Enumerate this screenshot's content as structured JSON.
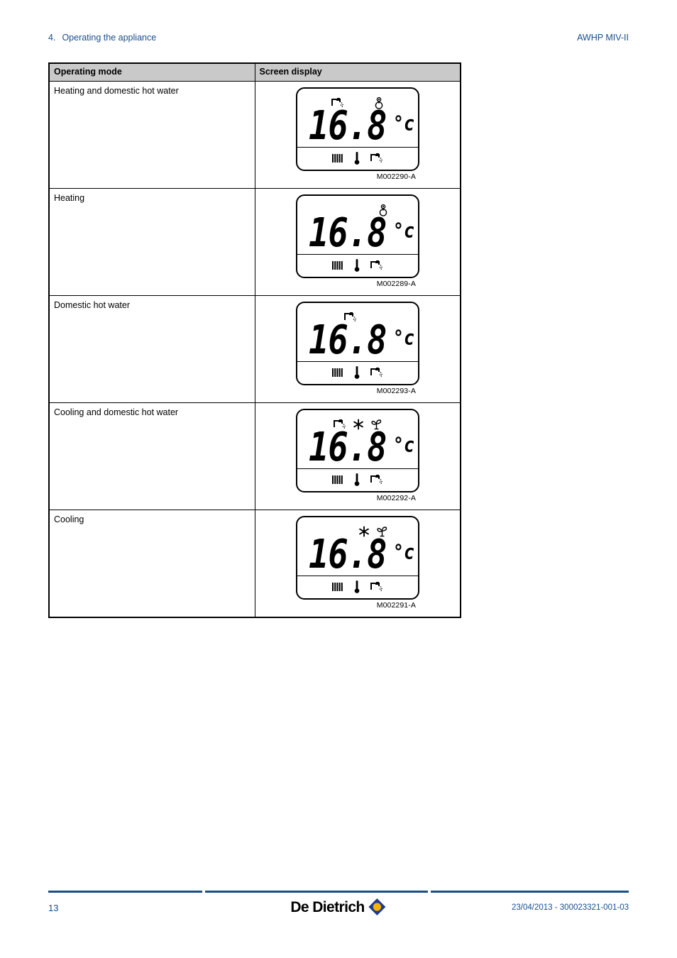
{
  "header": {
    "chapter_number": "4.",
    "chapter_title": "Operating the appliance",
    "document_title": "AWHP MIV-II"
  },
  "table": {
    "columns": {
      "mode": "Operating mode",
      "display": "Screen display"
    },
    "rows": [
      {
        "mode": "Heating and domestic hot water",
        "ref": "M002290-A",
        "temperature": "16.8",
        "unit": "°c",
        "top_icons": [
          "tap-icon",
          "sun-icon"
        ],
        "bottom_icons": [
          "radiator-icon",
          "thermometer-icon",
          "tap-icon"
        ]
      },
      {
        "mode": "Heating",
        "ref": "M002289-A",
        "temperature": "16.8",
        "unit": "°c",
        "top_icons": [
          "sun-icon"
        ],
        "bottom_icons": [
          "radiator-icon",
          "thermometer-icon",
          "tap-icon"
        ]
      },
      {
        "mode": "Domestic hot water",
        "ref": "M002293-A",
        "temperature": "16.8",
        "unit": "°c",
        "top_icons": [
          "tap-icon"
        ],
        "bottom_icons": [
          "radiator-icon",
          "thermometer-icon",
          "tap-icon"
        ]
      },
      {
        "mode": "Cooling and domestic hot water",
        "ref": "M002292-A",
        "temperature": "16.8",
        "unit": "°c",
        "top_icons": [
          "tap-icon",
          "snowflake-icon",
          "fan-icon"
        ],
        "bottom_icons": [
          "radiator-icon",
          "thermometer-icon",
          "tap-icon"
        ]
      },
      {
        "mode": "Cooling",
        "ref": "M002291-A",
        "temperature": "16.8",
        "unit": "°c",
        "top_icons": [
          "snowflake-icon",
          "fan-icon"
        ],
        "bottom_icons": [
          "radiator-icon",
          "thermometer-icon",
          "tap-icon"
        ]
      }
    ]
  },
  "footer": {
    "page_number": "13",
    "brand_name": "De Dietrich",
    "document_reference": "23/04/2013 - 300023321-001-03"
  },
  "colors": {
    "accent_blue": "#1a4e8a",
    "logo_blue": "#1f3b8f",
    "logo_yellow": "#f5b400",
    "header_gray": "#c9c9c9"
  }
}
